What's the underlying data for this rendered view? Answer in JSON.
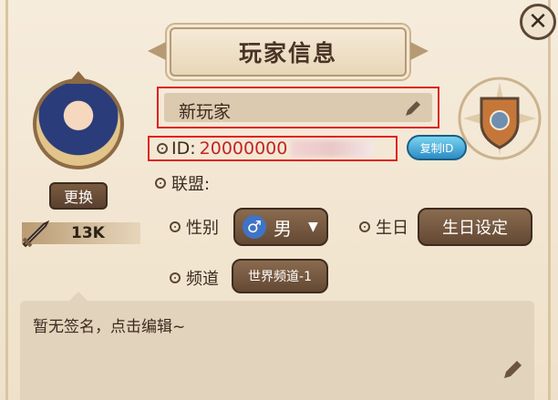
{
  "title": "玩家信息",
  "close_icon": "close-icon",
  "avatar": {
    "change_label": "更换"
  },
  "power": {
    "value": "13K",
    "icon": "sword-icon"
  },
  "name": {
    "value": "新玩家",
    "icon": "pencil-icon"
  },
  "id": {
    "label": "ID:",
    "value": "20000000",
    "copy_label": "复制ID"
  },
  "alliance": {
    "label": "联盟:",
    "value": ""
  },
  "gender": {
    "label": "性别",
    "value": "男",
    "icon": "male-icon"
  },
  "birthday": {
    "label": "生日",
    "button_label": "生日设定"
  },
  "channel": {
    "label": "频道",
    "value": "世界频道-1"
  },
  "signature": {
    "placeholder": "暂无签名，点击编辑~",
    "icon": "pencil-icon"
  },
  "colors": {
    "accent": "#e02020",
    "panel": "#f3e7d3",
    "button": "#634833"
  }
}
